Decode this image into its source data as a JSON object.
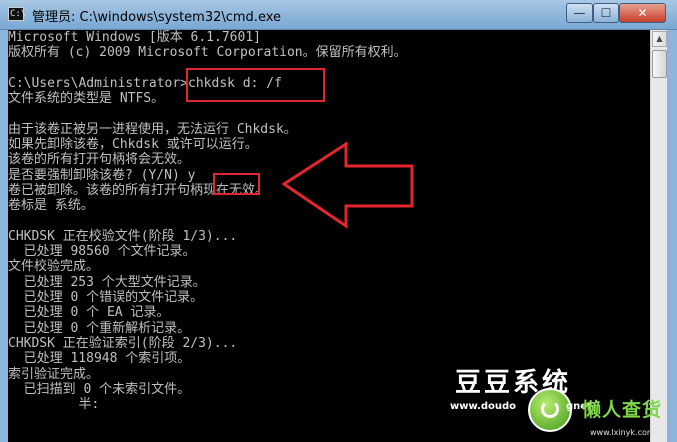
{
  "window": {
    "icon_text": "C:\\",
    "title": "管理员: C:\\windows\\system32\\cmd.exe",
    "buttons": {
      "minimize": "—",
      "maximize": "☐",
      "close": "✕"
    }
  },
  "console": {
    "lines": [
      "Microsoft Windows [版本 6.1.7601]",
      "版权所有 (c) 2009 Microsoft Corporation。保留所有权利。",
      "",
      "C:\\Users\\Administrator>chkdsk d: /f",
      "文件系统的类型是 NTFS。",
      "",
      "由于该卷正被另一进程使用，无法运行 Chkdsk。",
      "如果先卸除该卷，Chkdsk 或许可以运行。",
      "该卷的所有打开句柄将会无效。",
      "是否要强制卸除该卷? (Y/N) y",
      "卷已被卸除。该卷的所有打开句柄现在无效。",
      "卷标是 系统。",
      "",
      "CHKDSK 正在校验文件(阶段 1/3)...",
      "  已处理 98560 个文件记录。",
      "文件校验完成。",
      "  已处理 253 个大型文件记录。",
      "  已处理 0 个错误的文件记录。",
      "  已处理 0 个 EA 记录。",
      "  已处理 0 个重新解析记录。",
      "CHKDSK 正在验证索引(阶段 2/3)...",
      "  已处理 118948 个索引项。",
      "索引验证完成。",
      "  已扫描到 0 个未索引文件。",
      "         半:"
    ]
  },
  "scrollbar": {
    "up_arrow": "▲",
    "down_arrow": "▼"
  },
  "watermark": {
    "title": "豆豆系统",
    "url_left": "www.doudo",
    "url_right": "gnet",
    "brand": "懒人查货",
    "brand_url": "www.lxinyk.com"
  },
  "colors": {
    "console_text": "#c0c0c0",
    "console_bg": "#000000",
    "annotation_red": "#e3262e",
    "titlebar": "#8cb5da"
  }
}
